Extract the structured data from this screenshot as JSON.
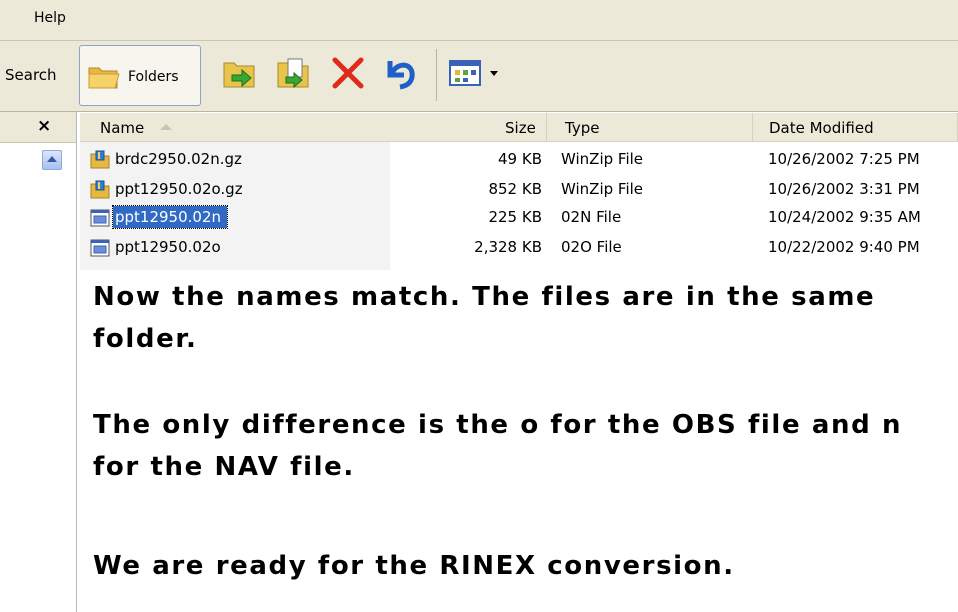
{
  "menu": {
    "help": "Help"
  },
  "toolbar": {
    "search_label": "Search",
    "folders_label": "Folders"
  },
  "left_panel": {
    "close": "×"
  },
  "columns": {
    "name": "Name",
    "size": "Size",
    "type": "Type",
    "date": "Date Modified"
  },
  "files": [
    {
      "name": "brdc2950.02n.gz",
      "size": "49 KB",
      "type": "WinZip File",
      "date": "10/26/2002 7:25 PM",
      "icon": "winzip-icon",
      "selected": false
    },
    {
      "name": "ppt12950.02o.gz",
      "size": "852 KB",
      "type": "WinZip File",
      "date": "10/26/2002 3:31 PM",
      "icon": "winzip-icon",
      "selected": false
    },
    {
      "name": "ppt12950.02n",
      "size": "225 KB",
      "type": "02N File",
      "date": "10/24/2002 9:35 AM",
      "icon": "generic-file-icon",
      "selected": true
    },
    {
      "name": "ppt12950.02o",
      "size": "2,328 KB",
      "type": "02O File",
      "date": "10/22/2002 9:40 PM",
      "icon": "generic-file-icon",
      "selected": false
    }
  ],
  "notes": [
    "Now the names match.  The files are in the same folder.",
    "The only difference is the o for the OBS file and n for the NAV file.",
    "We are ready for the RINEX conversion."
  ],
  "colors": {
    "selection": "#316ac5",
    "toolbar_bg": "#ece9d8"
  }
}
